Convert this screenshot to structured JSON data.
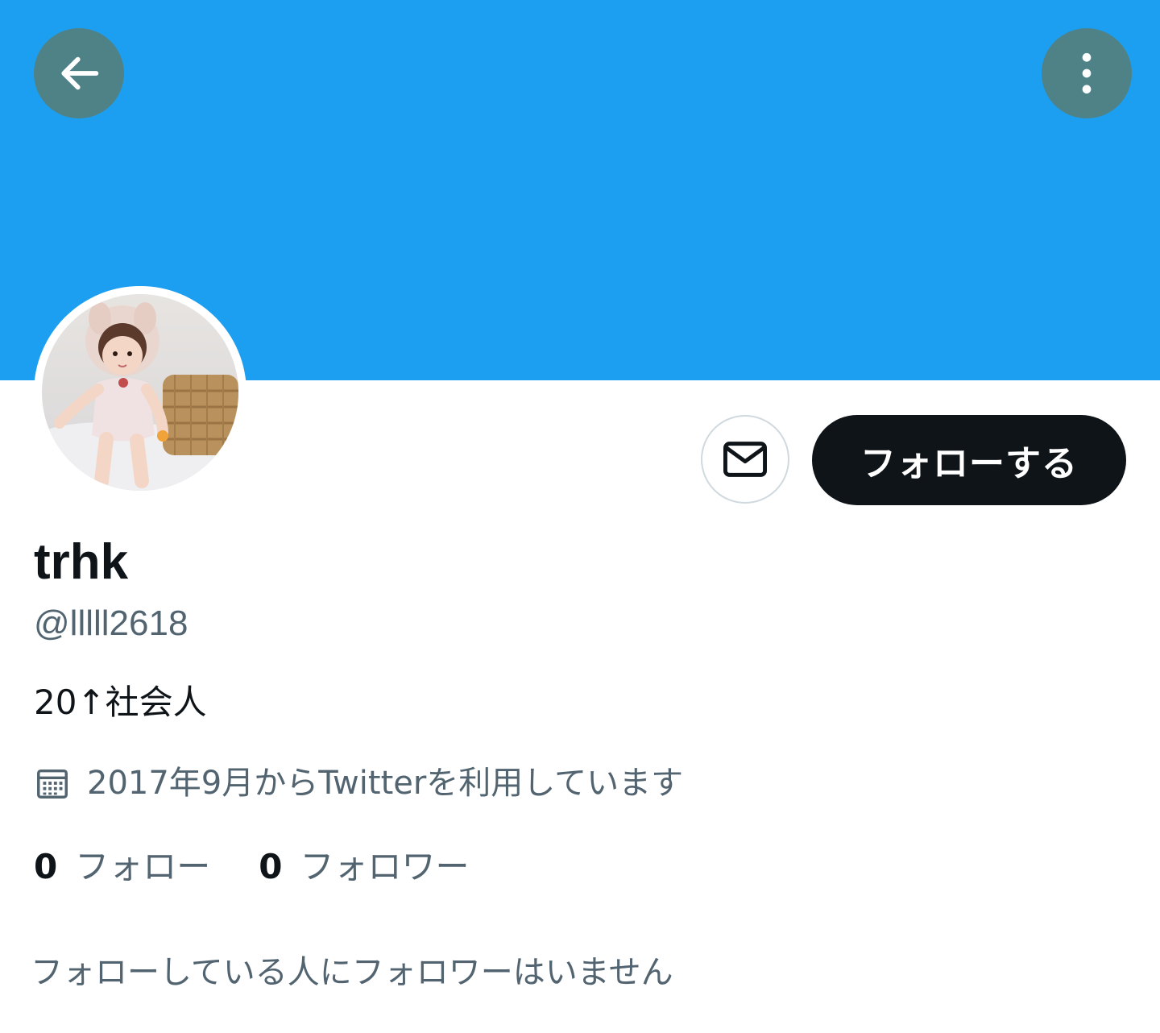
{
  "header": {
    "back_icon": "arrow-left-icon",
    "more_icon": "more-vertical-icon",
    "banner_color": "#1d9ff1"
  },
  "profile": {
    "avatar": "profile-photo",
    "display_name": "trhk",
    "handle": "@lllll2618",
    "bio": "20↑社会人",
    "joined_icon": "calendar-icon",
    "joined": "2017年9月からTwitterを利用しています"
  },
  "actions": {
    "message_icon": "envelope-icon",
    "follow_label": "フォローする"
  },
  "stats": {
    "following_count": "0",
    "following_label": "フォロー",
    "followers_count": "0",
    "followers_label": "フォロワー"
  },
  "note": "フォローしている人にフォロワーはいません"
}
